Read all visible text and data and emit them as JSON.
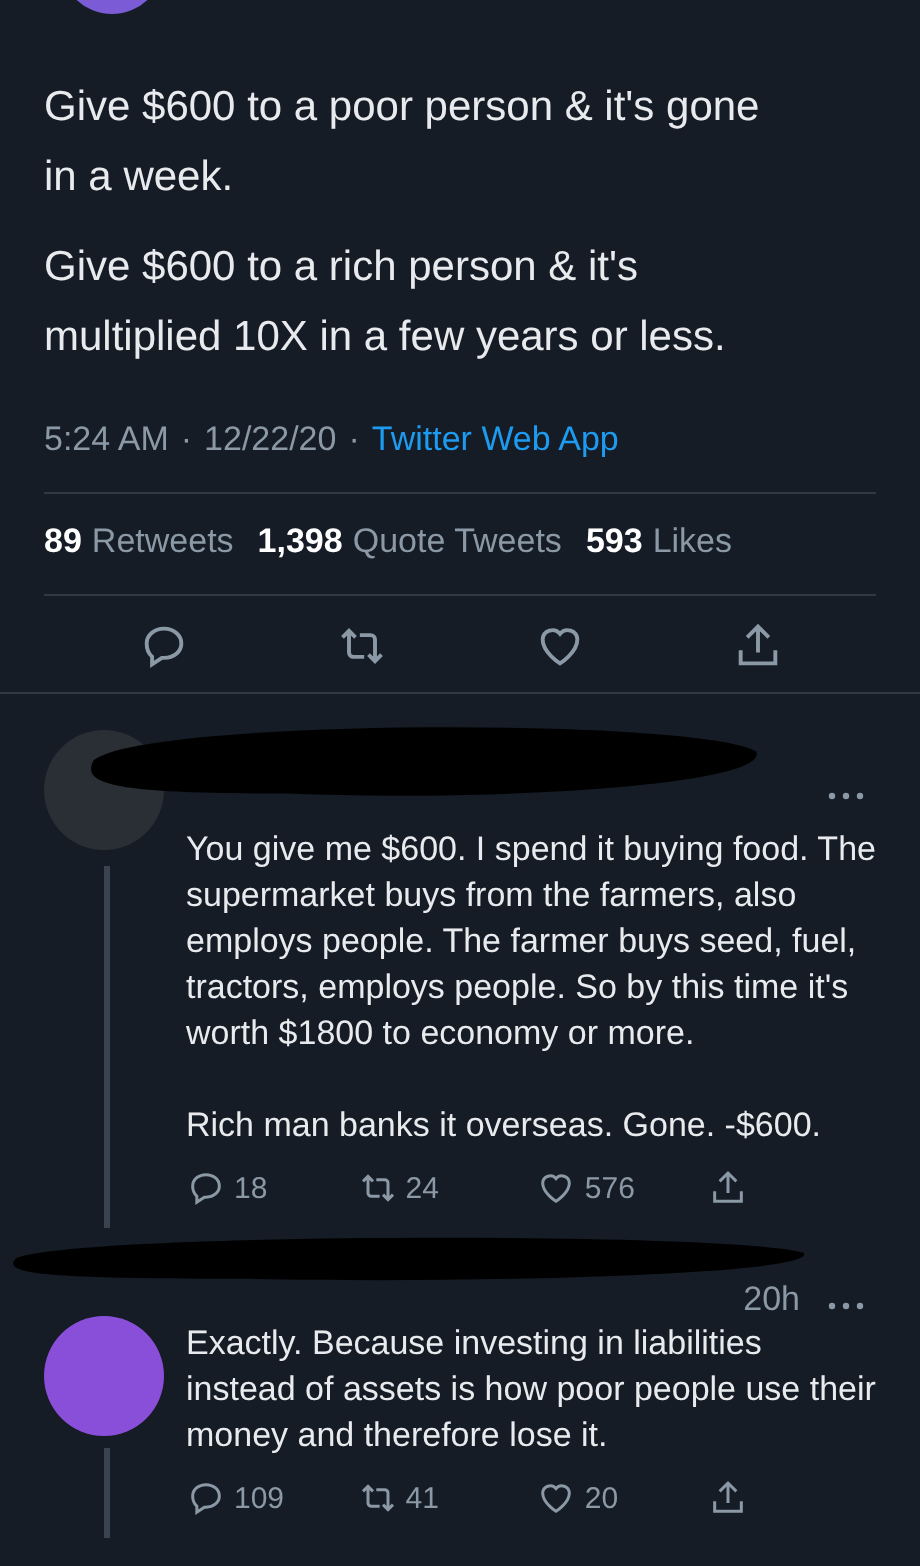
{
  "tweet": {
    "paragraphs": [
      "Give $600 to a poor person & it's gone in a week.",
      "Give $600 to a rich person & it's multiplied 10X in a few years or less."
    ],
    "time": "5:24 AM",
    "separator": "·",
    "date": "12/22/20",
    "source": "Twitter Web App",
    "stats": [
      {
        "count": "89",
        "label": "Retweets"
      },
      {
        "count": "1,398",
        "label": "Quote Tweets"
      },
      {
        "count": "593",
        "label": "Likes"
      }
    ]
  },
  "replies": [
    {
      "text": "You give me $600. I spend it buying food. The supermarket buys from the farmers, also employs people. The farmer buys seed, fuel, tractors, employs people. So by this time it's worth $1800 to economy or more.\n\nRich man banks it overseas. Gone. -$600.",
      "replies": "18",
      "retweets": "24",
      "likes": "576"
    },
    {
      "time": "20h",
      "text": "Exactly. Because investing in liabilities instead of assets is how poor people use their money and therefore lose it.",
      "replies": "109",
      "retweets": "41",
      "likes": "20"
    }
  ]
}
